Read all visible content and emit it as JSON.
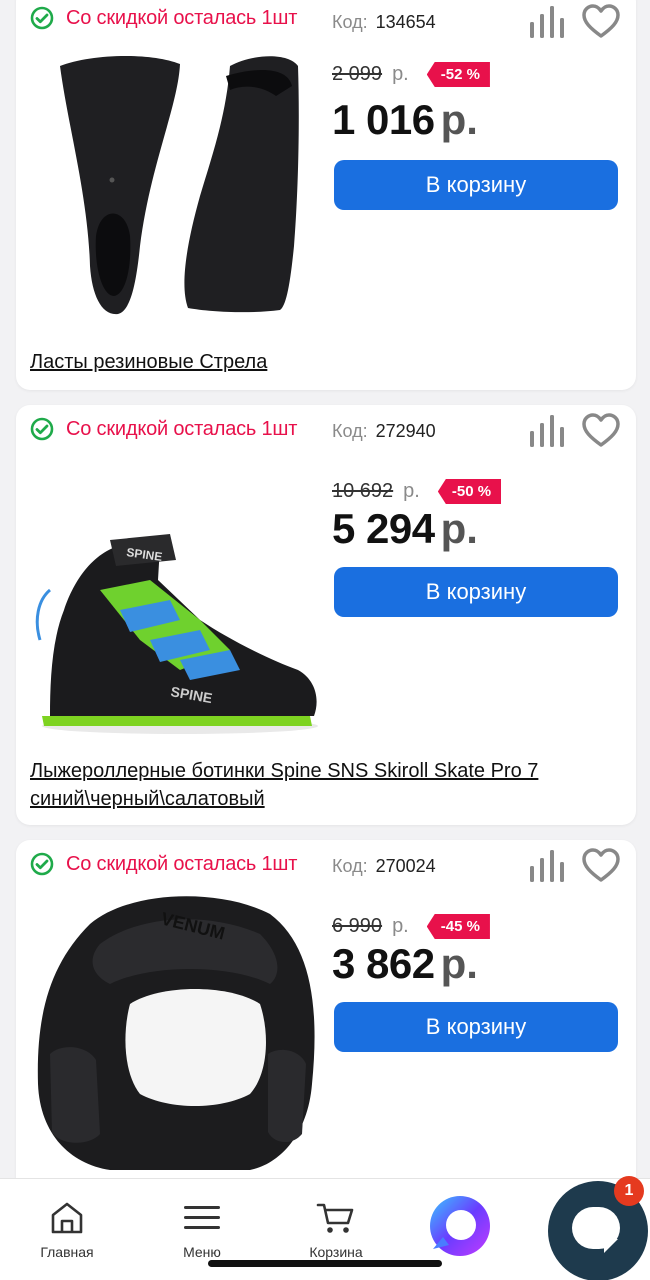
{
  "products": [
    {
      "stock_label": "Со скидкой осталась 1шт",
      "code_label": "Код:",
      "code": "134654",
      "old_price": "2 099",
      "old_currency": "р.",
      "discount": "-52 %",
      "price": "1 016",
      "currency": "р.",
      "cart_label": "В корзину",
      "title": "Ласты резиновые Стрела"
    },
    {
      "stock_label": "Со скидкой осталась 1шт",
      "code_label": "Код:",
      "code": "272940",
      "old_price": "10 692",
      "old_currency": "р.",
      "discount": "-50 %",
      "price": "5 294",
      "currency": "р.",
      "cart_label": "В корзину",
      "title": "Лыжероллерные ботинки Spine SNS Skiroll Skate Pro 7 синий\\черный\\салатовый"
    },
    {
      "stock_label": "Со скидкой осталась 1шт",
      "code_label": "Код:",
      "code": "270024",
      "old_price": "6 990",
      "old_currency": "р.",
      "discount": "-45 %",
      "price": "3 862",
      "currency": "р.",
      "cart_label": "В корзину",
      "title": ""
    }
  ],
  "nav": {
    "home": "Главная",
    "menu": "Меню",
    "cart": "Корзина"
  },
  "chat": {
    "badge": "1"
  },
  "colors": {
    "accent": "#1a6fe0",
    "sale": "#e8114b",
    "stock_check": "#1faa4a"
  },
  "icons": [
    "check-circle-icon",
    "compare-icon",
    "heart-icon",
    "home-icon",
    "menu-icon",
    "cart-icon",
    "chat-logo-icon",
    "chat-bubble-icon"
  ]
}
